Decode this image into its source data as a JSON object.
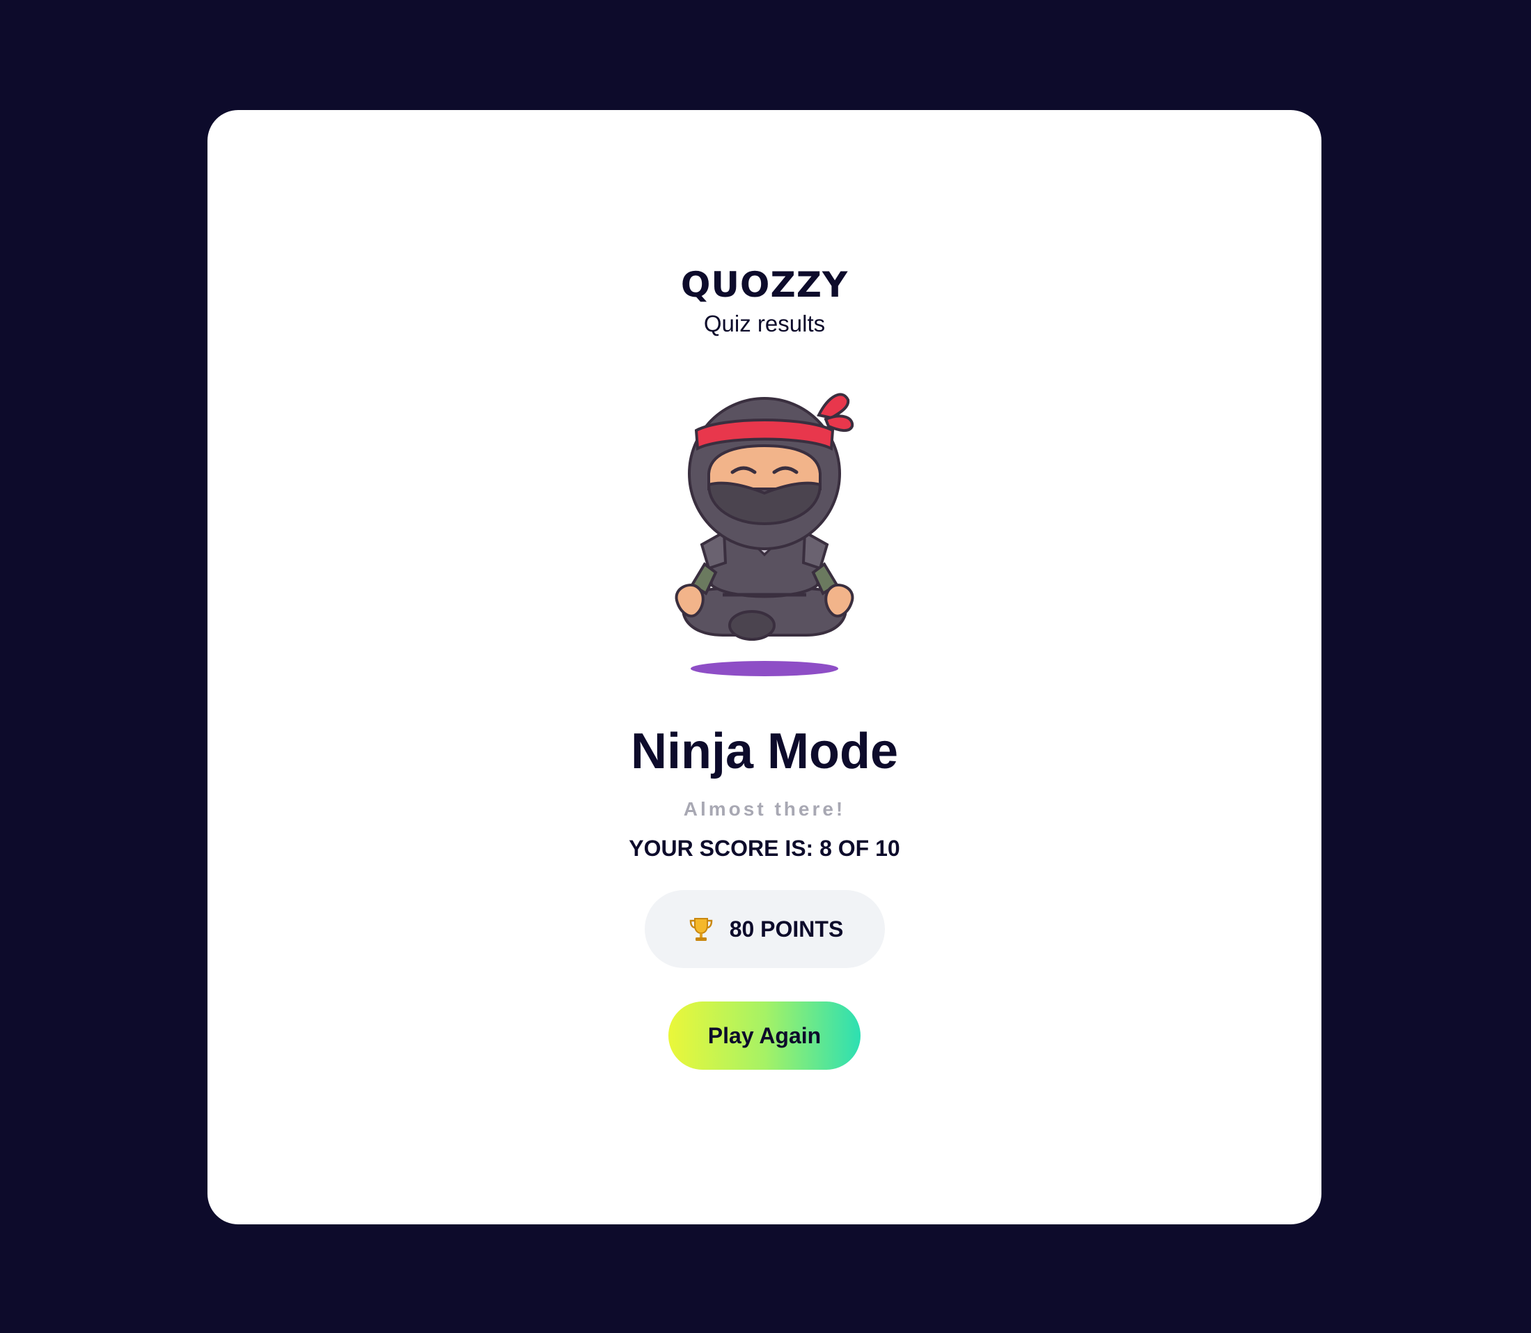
{
  "app": {
    "brand": "QUOZZY",
    "subtitle": "Quiz results"
  },
  "result": {
    "title": "Ninja Mode",
    "message": "Almost there!",
    "score_label": "YOUR SCORE IS:",
    "score_value": "8 OF 10",
    "points": "80 POINTS",
    "mascot_icon": "ninja-mascot",
    "trophy_icon": "trophy-icon"
  },
  "actions": {
    "play_again": "Play Again"
  },
  "colors": {
    "background": "#0d0b2b",
    "card": "#ffffff",
    "text": "#0d0b2b",
    "muted": "#a8a8b3",
    "pill": "#f1f3f6",
    "button_gradient": [
      "#eaf73a",
      "#a6f265",
      "#2ddfb2"
    ],
    "headband": "#e8374c",
    "shadow": "#8e4ec6"
  }
}
